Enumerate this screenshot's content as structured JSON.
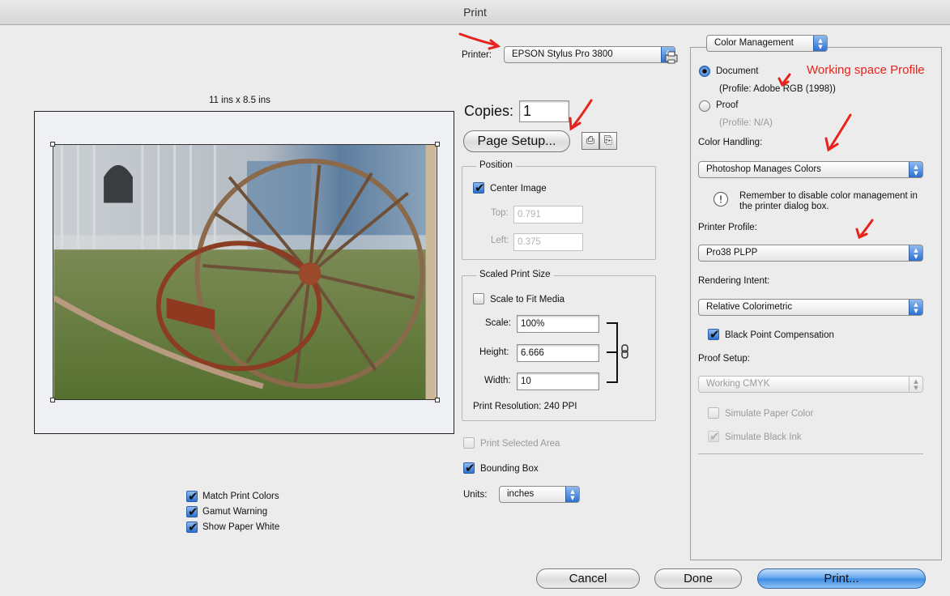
{
  "window": {
    "title": "Print"
  },
  "preview": {
    "size_label": "11 ins x 8.5 ins",
    "options": [
      {
        "label": "Match Print Colors",
        "checked": true
      },
      {
        "label": "Gamut Warning",
        "checked": true
      },
      {
        "label": "Show Paper White",
        "checked": true
      }
    ]
  },
  "printer": {
    "label": "Printer:",
    "value": "EPSON Stylus Pro 3800"
  },
  "copies": {
    "label": "Copies:",
    "value": "1"
  },
  "page_setup": {
    "label": "Page Setup..."
  },
  "position": {
    "title": "Position",
    "center_image": {
      "label": "Center Image",
      "checked": true
    },
    "top": {
      "label": "Top:",
      "value": "0.791"
    },
    "left": {
      "label": "Left:",
      "value": "0.375"
    }
  },
  "scaled_print_size": {
    "title": "Scaled Print Size",
    "scale_to_fit": {
      "label": "Scale to Fit Media",
      "checked": false
    },
    "scale": {
      "label": "Scale:",
      "value": "100%"
    },
    "height": {
      "label": "Height:",
      "value": "6.666"
    },
    "width": {
      "label": "Width:",
      "value": "10"
    },
    "resolution": "Print Resolution: 240 PPI"
  },
  "print_selected_area": {
    "label": "Print Selected Area",
    "checked": false
  },
  "bounding_box": {
    "label": "Bounding Box",
    "checked": true
  },
  "units": {
    "label": "Units:",
    "value": "inches"
  },
  "color_management": {
    "section_popup": "Color Management",
    "document": {
      "label": "Document",
      "profile": "(Profile: Adobe RGB (1998))",
      "selected": true
    },
    "proof": {
      "label": "Proof",
      "profile": "(Profile: N/A)",
      "selected": false
    },
    "color_handling": {
      "label": "Color Handling:",
      "value": "Photoshop Manages Colors"
    },
    "warning": "Remember to disable color management in the printer dialog box.",
    "printer_profile": {
      "label": "Printer Profile:",
      "value": "Pro38 PLPP"
    },
    "rendering_intent": {
      "label": "Rendering Intent:",
      "value": "Relative Colorimetric"
    },
    "black_point": {
      "label": "Black Point Compensation",
      "checked": true
    },
    "proof_setup": {
      "label": "Proof Setup:",
      "value": "Working CMYK"
    },
    "simulate_paper": {
      "label": "Simulate Paper Color",
      "checked": false
    },
    "simulate_ink": {
      "label": "Simulate Black Ink",
      "checked": true
    }
  },
  "annotation": {
    "text": "Working space Profile",
    "color": "#e8231d"
  },
  "buttons": {
    "cancel": "Cancel",
    "done": "Done",
    "print": "Print..."
  },
  "icons": {
    "printer_settings": "printer-settings-icon",
    "orientation_portrait": "portrait-orientation-icon",
    "orientation_landscape": "landscape-orientation-icon",
    "link": "chain-link-icon",
    "warning": "info-icon"
  }
}
